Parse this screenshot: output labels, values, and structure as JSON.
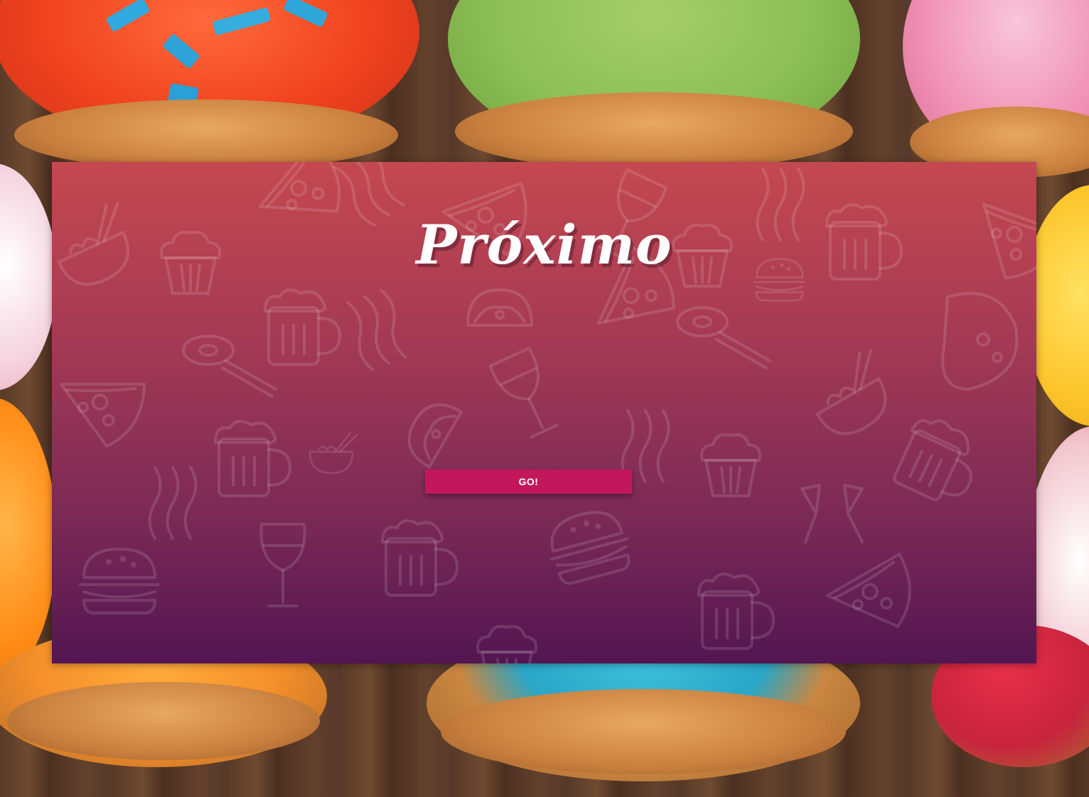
{
  "app": {
    "brand_name": "Próximo"
  },
  "actions": {
    "go_label": "GO!"
  },
  "colors": {
    "card_top": "#c4484f",
    "card_bottom": "#531652",
    "button": "#c2185b",
    "button_text": "#ffffff"
  },
  "icons": [
    "pizza-icon",
    "beer-mug-icon",
    "bacon-icon",
    "wine-glass-icon",
    "cupcake-icon",
    "burger-icon",
    "taco-icon",
    "sushi-chopsticks-icon",
    "noodle-bowl-icon",
    "champagne-toast-icon",
    "cheese-icon"
  ]
}
